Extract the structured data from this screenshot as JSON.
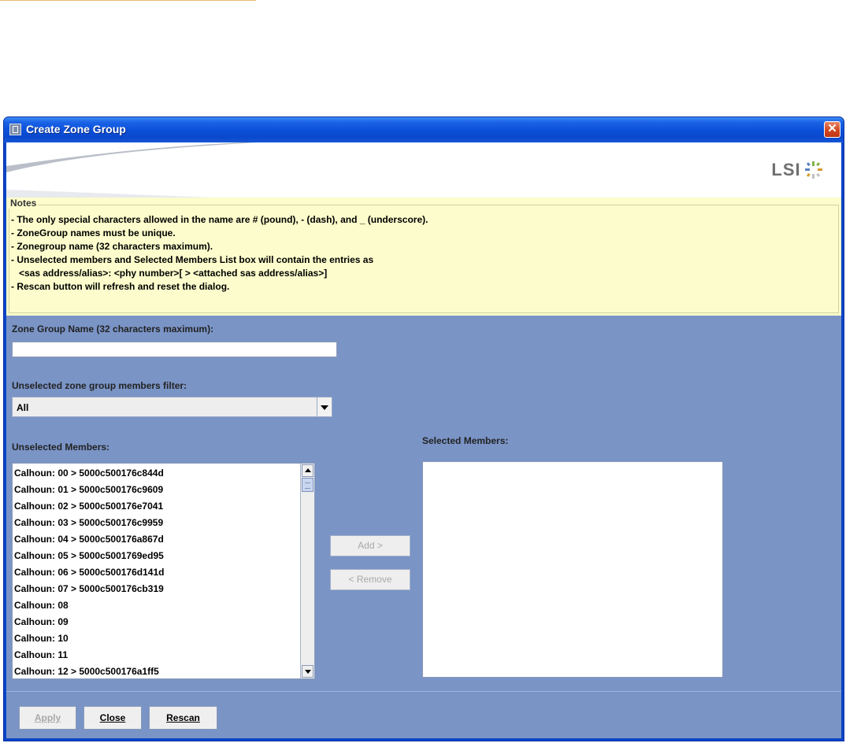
{
  "window": {
    "title": "Create Zone Group",
    "close_glyph": "✕",
    "logo_text": "LSI",
    "logo_colors": [
      "#5a7fc0",
      "#7fb241",
      "#d39a2a",
      "#c0c0c0"
    ]
  },
  "notes": {
    "legend": "Notes",
    "lines": [
      "- The only special characters allowed in the name are # (pound), - (dash), and _ (underscore).",
      "- ZoneGroup names must be unique.",
      "- Zonegroup name (32 characters maximum).",
      "- Unselected members and Selected Members List box will contain the entries as",
      "   <sas address/alias>: <phy number>[ > <attached sas address/alias>]",
      "- Rescan button will refresh and reset the dialog."
    ]
  },
  "form": {
    "name_label": "Zone Group Name (32 characters maximum):",
    "name_value": "",
    "filter_label": "Unselected zone group members filter:",
    "filter_value": "All",
    "unselected_label": "Unselected Members:",
    "selected_label": "Selected Members:",
    "unselected_items": [
      "Calhoun: 00 > 5000c500176c844d",
      "Calhoun: 01 > 5000c500176c9609",
      "Calhoun: 02 > 5000c500176e7041",
      "Calhoun: 03 > 5000c500176c9959",
      "Calhoun: 04 > 5000c500176a867d",
      "Calhoun: 05 > 5000c5001769ed95",
      "Calhoun: 06 > 5000c500176d141d",
      "Calhoun: 07 > 5000c500176cb319",
      "Calhoun: 08",
      "Calhoun: 09",
      "Calhoun: 10",
      "Calhoun: 11",
      "Calhoun: 12 > 5000c500176a1ff5"
    ],
    "selected_items": [],
    "add_label": "Add >",
    "remove_label": "< Remove"
  },
  "footer": {
    "apply_label": "Apply",
    "close_label": "Close",
    "rescan_label": "Rescan"
  },
  "icons": {
    "app": "app-icon",
    "close": "close-icon",
    "combo_arrow": "chevron-down-icon",
    "scroll_up": "scroll-up-arrow-icon",
    "scroll_down": "scroll-down-arrow-icon"
  }
}
